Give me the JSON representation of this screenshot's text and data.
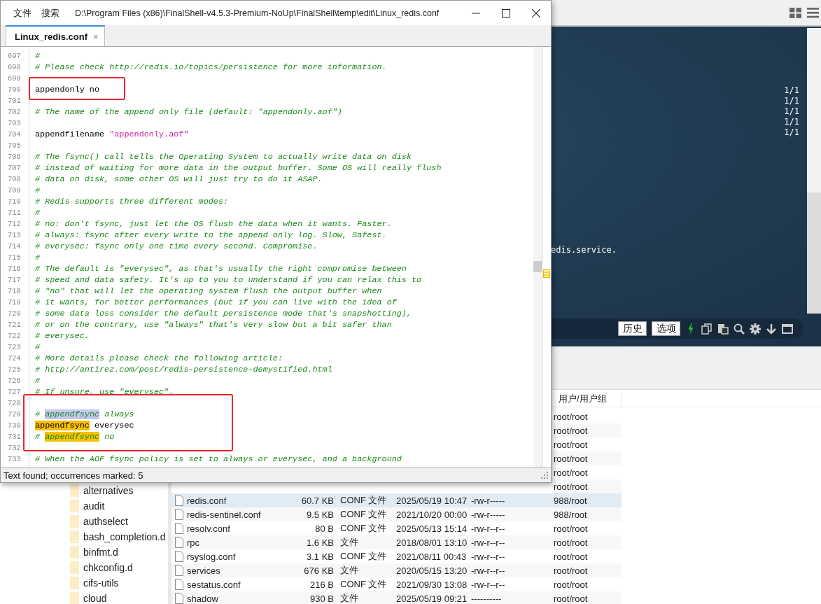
{
  "editor": {
    "menu": [
      "文件",
      "搜索"
    ],
    "path": "D:\\Program Files (x86)\\FinalShell-v4.5.3-Premium-NoUp\\FinalShell\\temp\\edit\\Linux_redis.conf",
    "tabs": [
      {
        "label": "Linux_redis.conf",
        "selected": true,
        "close": "×"
      }
    ],
    "lines": [
      {
        "number": "697",
        "segments": [
          {
            "text": "#",
            "kind": "comment"
          }
        ]
      },
      {
        "number": "698",
        "segments": [
          {
            "text": "# Please check http://redis.io/topics/persistence for more information.",
            "kind": "comment"
          }
        ]
      },
      {
        "number": "699"
      },
      {
        "number": "700",
        "segments": [
          {
            "text": "appendonly no",
            "kind": "code"
          }
        ]
      },
      {
        "number": "701"
      },
      {
        "number": "702",
        "segments": [
          {
            "text": "# The name of the append only file (default: \"appendonly.aof\")",
            "kind": "comment"
          }
        ]
      },
      {
        "number": "703"
      },
      {
        "number": "704",
        "segments": [
          {
            "text": "appendfilename ",
            "kind": "code"
          },
          {
            "text": "\"appendonly.aof\"",
            "kind": "string"
          }
        ]
      },
      {
        "number": "705"
      },
      {
        "number": "706",
        "segments": [
          {
            "text": "# The fsync() call tells the Operating System to actually write data on disk",
            "kind": "comment"
          }
        ]
      },
      {
        "number": "707",
        "segments": [
          {
            "text": "# instead of waiting for more data in the output buffer. Some OS will really flush",
            "kind": "comment"
          }
        ]
      },
      {
        "number": "708",
        "segments": [
          {
            "text": "# data on disk, some other OS will just try to do it ASAP.",
            "kind": "comment"
          }
        ]
      },
      {
        "number": "709",
        "segments": [
          {
            "text": "#",
            "kind": "comment"
          }
        ]
      },
      {
        "number": "710",
        "segments": [
          {
            "text": "# Redis supports three different modes:",
            "kind": "comment"
          }
        ]
      },
      {
        "number": "711",
        "segments": [
          {
            "text": "#",
            "kind": "comment"
          }
        ]
      },
      {
        "number": "712",
        "segments": [
          {
            "text": "# no: don't fsync, just let the OS flush the data when it wants. Faster.",
            "kind": "comment"
          }
        ]
      },
      {
        "number": "713",
        "segments": [
          {
            "text": "# always: fsync after every write to the append only log. Slow, Safest.",
            "kind": "comment"
          }
        ]
      },
      {
        "number": "714",
        "segments": [
          {
            "text": "# everysec: fsync only one time every second. Compromise.",
            "kind": "comment"
          }
        ]
      },
      {
        "number": "715",
        "segments": [
          {
            "text": "#",
            "kind": "comment"
          }
        ]
      },
      {
        "number": "716",
        "segments": [
          {
            "text": "# The default is \"everysec\", as that's usually the right compromise between",
            "kind": "comment"
          }
        ]
      },
      {
        "number": "717",
        "segments": [
          {
            "text": "# speed and data safety. It's up to you to understand if you can relax this to",
            "kind": "comment"
          }
        ]
      },
      {
        "number": "718",
        "segments": [
          {
            "text": "# \"no\" that will let the operating system flush the output buffer when",
            "kind": "comment"
          }
        ]
      },
      {
        "number": "719",
        "segments": [
          {
            "text": "# it wants, for better performances (but if you can live with the idea of",
            "kind": "comment"
          }
        ]
      },
      {
        "number": "720",
        "segments": [
          {
            "text": "# some data loss consider the default persistence mode that's snapshotting),",
            "kind": "comment"
          }
        ]
      },
      {
        "number": "721",
        "segments": [
          {
            "text": "# or on the contrary, use \"always\" that's very slow but a bit safer than",
            "kind": "comment"
          }
        ]
      },
      {
        "number": "722",
        "segments": [
          {
            "text": "# everysec.",
            "kind": "comment"
          }
        ]
      },
      {
        "number": "723",
        "segments": [
          {
            "text": "#",
            "kind": "comment"
          }
        ]
      },
      {
        "number": "724",
        "segments": [
          {
            "text": "# More details please check the following article:",
            "kind": "comment"
          }
        ]
      },
      {
        "number": "725",
        "segments": [
          {
            "text": "# http://antirez.com/post/redis-persistence-demystified.html",
            "kind": "comment"
          }
        ]
      },
      {
        "number": "726",
        "segments": [
          {
            "text": "#",
            "kind": "comment"
          }
        ]
      },
      {
        "number": "727",
        "segments": [
          {
            "text": "# If unsure, use \"everysec\".",
            "kind": "comment"
          }
        ]
      },
      {
        "number": "728"
      },
      {
        "number": "729",
        "segments": [
          {
            "text": "# ",
            "kind": "comment"
          },
          {
            "text": "appendfsync",
            "kind": "comment",
            "match": true,
            "current": true
          },
          {
            "text": " always",
            "kind": "comment"
          }
        ]
      },
      {
        "number": "730",
        "segments": [
          {
            "text": "appendfsync",
            "kind": "code",
            "match": true,
            "current": false
          },
          {
            "text": " everysec",
            "kind": "code"
          }
        ]
      },
      {
        "number": "731",
        "segments": [
          {
            "text": "# ",
            "kind": "comment"
          },
          {
            "text": "appendfsync",
            "kind": "comment",
            "match": true,
            "current": false
          },
          {
            "text": " no",
            "kind": "comment"
          }
        ]
      },
      {
        "number": "732"
      },
      {
        "number": "733",
        "segments": [
          {
            "text": "# When the AOF fsync policy is set to always or everysec, and a background",
            "kind": "comment"
          }
        ]
      }
    ],
    "status": "Text found; occurrences marked: 5"
  },
  "terminal": {
    "counters": [
      "1/1",
      "1/1",
      "1/1",
      "1/1",
      "1/1"
    ],
    "output": "edis.service.",
    "buttons": [
      "历史",
      "选项"
    ]
  },
  "tree": {
    "items": [
      "alternatives",
      "audit",
      "authselect",
      "bash_completion.d",
      "binfmt.d",
      "chkconfig.d",
      "cifs-utils",
      "cloud"
    ]
  },
  "file_table": {
    "columns": [
      {
        "label": "用户/用户组"
      }
    ],
    "rows": [
      {
        "user": "root/root",
        "selected": false
      },
      {
        "user": "root/root",
        "selected": false
      },
      {
        "user": "root/root",
        "selected": false
      },
      {
        "user": "root/root",
        "selected": false
      },
      {
        "user": "root/root",
        "selected": false
      },
      {
        "user": "root/root",
        "selected": false
      },
      {
        "name": "redis.conf",
        "size": "60.7 KB",
        "type": "CONF 文件",
        "date": "2025/05/19 10:47",
        "perm": "-rw-r-----",
        "user": "988/root",
        "selected": true
      },
      {
        "name": "redis-sentinel.conf",
        "size": "9.5 KB",
        "type": "CONF 文件",
        "date": "2021/10/20 00:00",
        "perm": "-rw-r-----",
        "user": "988/root",
        "selected": false
      },
      {
        "name": "resolv.conf",
        "size": "80 B",
        "type": "CONF 文件",
        "date": "2025/05/13 15:14",
        "perm": "-rw-r--r--",
        "user": "root/root",
        "selected": false
      },
      {
        "name": "rpc",
        "size": "1.6 KB",
        "type": "文件",
        "date": "2018/08/01 13:10",
        "perm": "-rw-r--r--",
        "user": "root/root",
        "selected": false
      },
      {
        "name": "rsyslog.conf",
        "size": "3.1 KB",
        "type": "CONF 文件",
        "date": "2021/08/11 00:43",
        "perm": "-rw-r--r--",
        "user": "root/root",
        "selected": false
      },
      {
        "name": "services",
        "size": "676 KB",
        "type": "文件",
        "date": "2020/05/15 13:20",
        "perm": "-rw-r--r--",
        "user": "root/root",
        "selected": false
      },
      {
        "name": "sestatus.conf",
        "size": "216 B",
        "type": "CONF 文件",
        "date": "2021/09/30 13:08",
        "perm": "-rw-r--r--",
        "user": "root/root",
        "selected": false
      },
      {
        "name": "shadow",
        "size": "930 B",
        "type": "文件",
        "date": "2025/05/19 09:21",
        "perm": "----------",
        "user": "root/root",
        "selected": false
      }
    ]
  }
}
